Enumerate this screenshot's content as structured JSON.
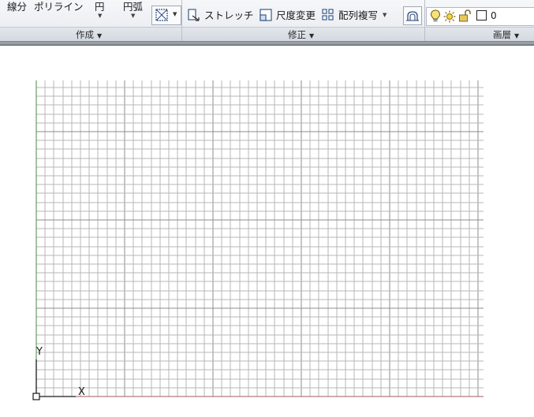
{
  "ribbon": {
    "draw_panel": {
      "tools": {
        "line_label": "線分",
        "polyline_label": "ポリライン",
        "circle_label": "円",
        "arc_label": "円弧"
      },
      "title": "作成"
    },
    "modify_panel": {
      "tools": {
        "stretch_label": "ストレッチ",
        "scale_label": "尺度変更",
        "array_label": "配列複写"
      },
      "title": "修正"
    },
    "layer_panel": {
      "current_layer": "0",
      "title": "画層"
    }
  },
  "drawing_area": {
    "ucs_icon": {
      "y_axis_label": "Y",
      "x_axis_label": "X"
    }
  }
}
